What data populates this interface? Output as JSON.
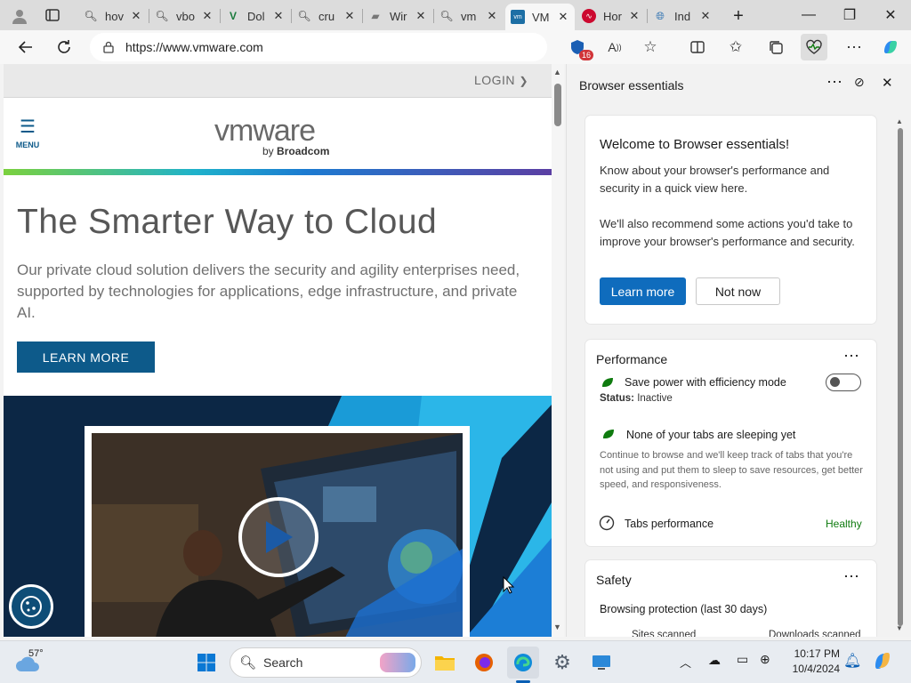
{
  "tabs": [
    {
      "label": "hov",
      "icon": "search-icon"
    },
    {
      "label": "vbo",
      "icon": "search-icon"
    },
    {
      "label": "Dol",
      "icon": "document-icon"
    },
    {
      "label": "cru",
      "icon": "search-icon"
    },
    {
      "label": "Wir",
      "icon": "archive-icon"
    },
    {
      "label": "vm",
      "icon": "search-icon"
    },
    {
      "label": "VM",
      "icon": "vmware-icon"
    },
    {
      "label": "Hor",
      "icon": "broadcom-icon"
    },
    {
      "label": "Ind",
      "icon": "globe-icon"
    }
  ],
  "address": {
    "url": "https://www.vmware.com"
  },
  "toolbar": {
    "extension_badge": "16"
  },
  "page": {
    "login": "LOGIN",
    "menu": "MENU",
    "logo_main": "vmware",
    "logo_by": "by",
    "logo_brand": "Broadcom",
    "headline": "The Smarter Way to Cloud",
    "lead": "Our private cloud solution delivers the security and agility enterprises need, supported by technologies for applications, edge infrastructure, and private AI.",
    "cta": "LEARN MORE"
  },
  "panel": {
    "title": "Browser essentials",
    "welcome": {
      "heading": "Welcome to Browser essentials!",
      "p1": "Know about your browser's performance and security in a quick view here.",
      "p2": "We'll also recommend some actions you'd take to improve your browser's performance and security.",
      "primary": "Learn more",
      "secondary": "Not now"
    },
    "performance": {
      "heading": "Performance",
      "efficiency": "Save power with efficiency mode",
      "status_label": "Status:",
      "status_value": "Inactive",
      "sleeping": "None of your tabs are sleeping yet",
      "sleeping_desc": "Continue to browse and we'll keep track of tabs that you're not using and put them to sleep to save resources, get better speed, and responsiveness.",
      "tabs_perf": "Tabs performance",
      "tabs_perf_status": "Healthy"
    },
    "safety": {
      "heading": "Safety",
      "browsing": "Browsing protection (last 30 days)",
      "sites": "Sites scanned",
      "downloads": "Downloads scanned"
    }
  },
  "taskbar": {
    "weather": "57°",
    "search": "Search",
    "time": "10:17 PM",
    "date": "10/4/2024"
  },
  "colors": {
    "accent": "#0f6cbd",
    "vmware_blue": "#0d5a8a",
    "healthy": "#0f7b0f"
  }
}
